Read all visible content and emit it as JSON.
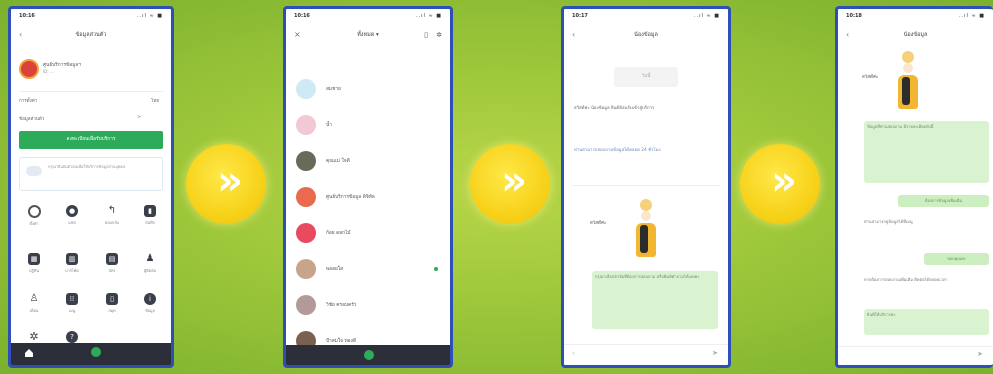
{
  "status": {
    "time_1": "10:16",
    "time_2": "10:16",
    "time_3": "10:17",
    "time_4": "10:18",
    "signals": "..ıl ≈ ■"
  },
  "phone1": {
    "header_title": "ข้อมูลส่วนตัว",
    "profile_name": "ศูนย์บริการข้อมูลฯ",
    "profile_sub": "ID: ...",
    "row1_label": "การตั้งค่า",
    "row1_value": "ไทย",
    "row2_label": "ข้อมูลส่วนตัว",
    "row2_value": ">",
    "add_button": "ลงทะเบียนเพื่อรับบริการ",
    "notice": "กรุณายืนยันตัวตนเพื่อใช้บริการข้อมูลส่วนบุคคล",
    "grid": [
      "ตั้งค่า",
      "แชท",
      "ตอบกลับ",
      "บันทึก",
      "ปฏิทิน",
      "บาร์โค้ด",
      "บัตร",
      "ผู้ติดต่อ",
      "เพื่อน",
      "เมนู",
      "สมุด",
      "ข้อมูล",
      "ตั้งค่า",
      "ช่วยเหลือ"
    ]
  },
  "phone2": {
    "header_title": "ทั้งหมด ▾",
    "chats": [
      "สมชาย",
      "น้ำ",
      "คุณแม่ ใจดี",
      "ศูนย์บริการข้อมูล ดิจิทัล",
      "ก้อย ดอกไม้",
      "พลอยใส",
      "วิชัย ครอบครัว",
      "ป้าสมใจ ทองดี"
    ]
  },
  "phone3": {
    "header_title": "น้องข้อมูล",
    "date_chip": "วันนี้",
    "msg1": "สวัสดีค่ะ น้องข้อมูล ยินดีต้อนรับเข้าสู่บริการ",
    "msg2": "ท่านสามารถสอบถามข้อมูลได้ตลอด 24 ชั่วโมง",
    "greeting": "สวัสดีค่ะ",
    "reply": "กรุณาเลือกหัวข้อที่ต้องการสอบถาม หรือพิมพ์คำถามได้เลยค่ะ"
  },
  "phone4": {
    "header_title": "น้องข้อมูล",
    "greeting": "สวัสดีค่ะ",
    "msg1": "ข้อมูลที่ท่านสอบถาม มีรายละเอียดดังนี้",
    "btn1": "ต้องการข้อมูลเพิ่มเติม",
    "msg2": "ท่านสามารถดูข้อมูลได้ที่เมนู",
    "btn2": "ขอบคุณค่ะ",
    "msg3": "หากต้องการสอบถามเพิ่มเติม ติดต่อได้ตลอดเวลา",
    "msg4": "ยินดีให้บริการค่ะ"
  },
  "colors": {
    "accent": "#2eab5a",
    "frame": "#2f4fb8",
    "arrow": "#f7d21a"
  }
}
